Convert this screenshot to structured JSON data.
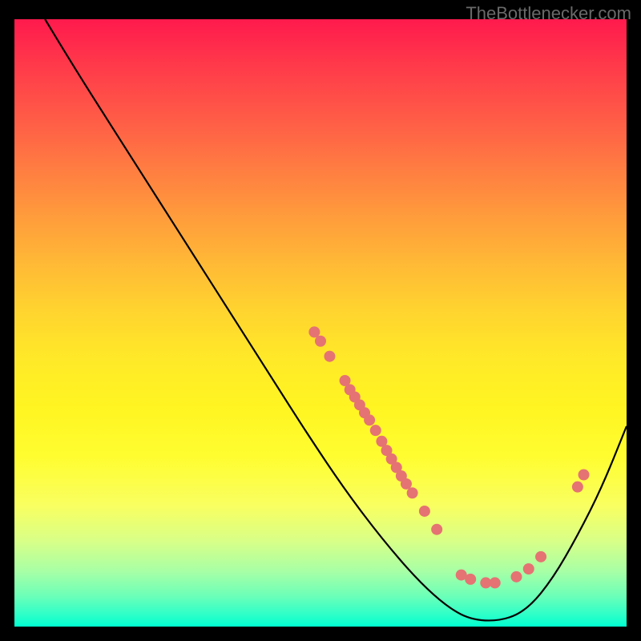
{
  "watermark": "TheBottlenecker.com",
  "chart_data": {
    "type": "line",
    "title": "",
    "xlabel": "",
    "ylabel": "",
    "xlim": [
      0,
      100
    ],
    "ylim": [
      0,
      100
    ],
    "grid": false,
    "curve": [
      {
        "x": 5.0,
        "y": 100.0
      },
      {
        "x": 8.0,
        "y": 95.0
      },
      {
        "x": 12.0,
        "y": 88.5
      },
      {
        "x": 18.0,
        "y": 79.0
      },
      {
        "x": 24.0,
        "y": 69.5
      },
      {
        "x": 30.0,
        "y": 60.0
      },
      {
        "x": 36.0,
        "y": 50.5
      },
      {
        "x": 42.0,
        "y": 41.0
      },
      {
        "x": 48.0,
        "y": 31.5
      },
      {
        "x": 54.0,
        "y": 22.5
      },
      {
        "x": 60.0,
        "y": 14.5
      },
      {
        "x": 66.0,
        "y": 7.5
      },
      {
        "x": 71.0,
        "y": 3.0
      },
      {
        "x": 75.0,
        "y": 1.0
      },
      {
        "x": 80.0,
        "y": 1.0
      },
      {
        "x": 84.0,
        "y": 3.0
      },
      {
        "x": 88.0,
        "y": 8.0
      },
      {
        "x": 92.0,
        "y": 15.0
      },
      {
        "x": 96.0,
        "y": 23.0
      },
      {
        "x": 100.0,
        "y": 33.0
      }
    ],
    "points": [
      {
        "x": 49.0,
        "y": 48.5
      },
      {
        "x": 50.0,
        "y": 47.0
      },
      {
        "x": 51.5,
        "y": 44.5
      },
      {
        "x": 54.0,
        "y": 40.5
      },
      {
        "x": 54.8,
        "y": 39.0
      },
      {
        "x": 55.6,
        "y": 37.8
      },
      {
        "x": 56.4,
        "y": 36.5
      },
      {
        "x": 57.2,
        "y": 35.2
      },
      {
        "x": 58.0,
        "y": 34.0
      },
      {
        "x": 59.0,
        "y": 32.3
      },
      {
        "x": 60.0,
        "y": 30.5
      },
      {
        "x": 60.8,
        "y": 29.0
      },
      {
        "x": 61.6,
        "y": 27.6
      },
      {
        "x": 62.4,
        "y": 26.2
      },
      {
        "x": 63.2,
        "y": 24.8
      },
      {
        "x": 64.0,
        "y": 23.5
      },
      {
        "x": 65.0,
        "y": 22.0
      },
      {
        "x": 67.0,
        "y": 19.0
      },
      {
        "x": 69.0,
        "y": 16.0
      },
      {
        "x": 73.0,
        "y": 8.5
      },
      {
        "x": 74.5,
        "y": 7.8
      },
      {
        "x": 77.0,
        "y": 7.2
      },
      {
        "x": 78.5,
        "y": 7.2
      },
      {
        "x": 82.0,
        "y": 8.2
      },
      {
        "x": 84.0,
        "y": 9.5
      },
      {
        "x": 86.0,
        "y": 11.5
      },
      {
        "x": 92.0,
        "y": 23.0
      },
      {
        "x": 93.0,
        "y": 25.0
      }
    ],
    "colors": {
      "line": "#000000",
      "point_fill": "#e57373",
      "point_stroke": "#d14b4b"
    }
  }
}
